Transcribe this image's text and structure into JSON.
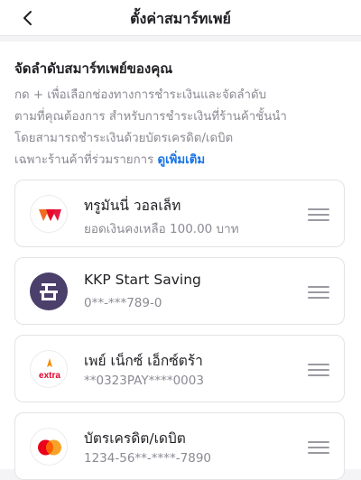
{
  "header": {
    "title": "ตั้งค่าสมาร์ทเพย์"
  },
  "section": {
    "title": "จัดลำดับสมาร์ทเพย์ของคุณ",
    "description_lines": [
      "กด + เพื่อเลือกช่องทางการชำระเงินและจัดลำดับ",
      "ตามที่คุณต้องการ สำหรับการชำระเงินที่ร้านค้าชั้นนำ",
      "โดยสามารถชำระเงินด้วยบัตรเครดิต/เดบิต",
      "เฉพาะร้านค้าที่ร่วมรายการ"
    ],
    "more_link": "ดูเพิ่มเติม"
  },
  "methods": [
    {
      "name": "ทรูมันนี่ วอลเล็ท",
      "detail": "ยอดเงินคงเหลือ 100.00 บาท",
      "icon": "truemoney-wallet-icon"
    },
    {
      "name": "KKP Start Saving",
      "detail": "0**-***789-0",
      "icon": "kkp-bank-icon"
    },
    {
      "name": "เพย์ เน็กซ์ เอ็กซ์ตร้า",
      "detail": "**0323PAY****0003",
      "icon": "paynext-extra-icon",
      "icon_text": "extra"
    },
    {
      "name": "บัตรเครดิต/เดบิต",
      "detail": "1234-56**-****-7890",
      "icon": "mastercard-icon"
    }
  ],
  "colors": {
    "accent_link": "#1a74e8",
    "truemoney_orange": "#f26b21",
    "truemoney_red": "#e4002b",
    "kkp_purple": "#4b3f6b",
    "extra_orange": "#f08c00",
    "mastercard_red": "#eb001b",
    "mastercard_yellow": "#f79e1b"
  }
}
